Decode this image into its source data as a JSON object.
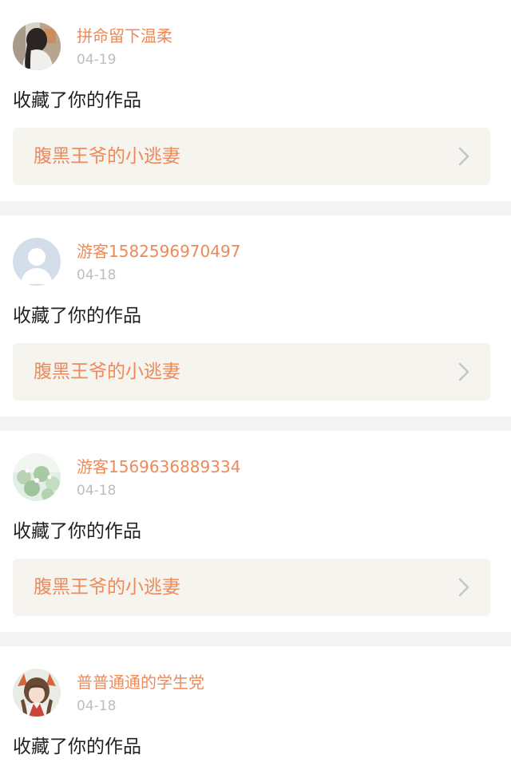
{
  "notifications": [
    {
      "username": "拼命留下温柔",
      "date": "04-19",
      "action": "收藏了你的作品",
      "work_title": "腹黑王爷的小逃妻",
      "avatar_icon": "girl-photo-avatar"
    },
    {
      "username": "游客1582596970497",
      "date": "04-18",
      "action": "收藏了你的作品",
      "work_title": "腹黑王爷的小逃妻",
      "avatar_icon": "default-user-avatar"
    },
    {
      "username": "游客1569636889334",
      "date": "04-18",
      "action": "收藏了你的作品",
      "work_title": "腹黑王爷的小逃妻",
      "avatar_icon": "flower-photo-avatar"
    },
    {
      "username": "普普通通的学生党",
      "date": "04-18",
      "action": "收藏了你的作品",
      "avatar_icon": "anime-girl-avatar"
    }
  ],
  "colors": {
    "accent": "#ee8a59",
    "date_gray": "#bdbdbd",
    "work_card_bg": "#f5f4ef",
    "separator_bg": "#f4f4f4",
    "chevron": "#c4c4c4"
  }
}
